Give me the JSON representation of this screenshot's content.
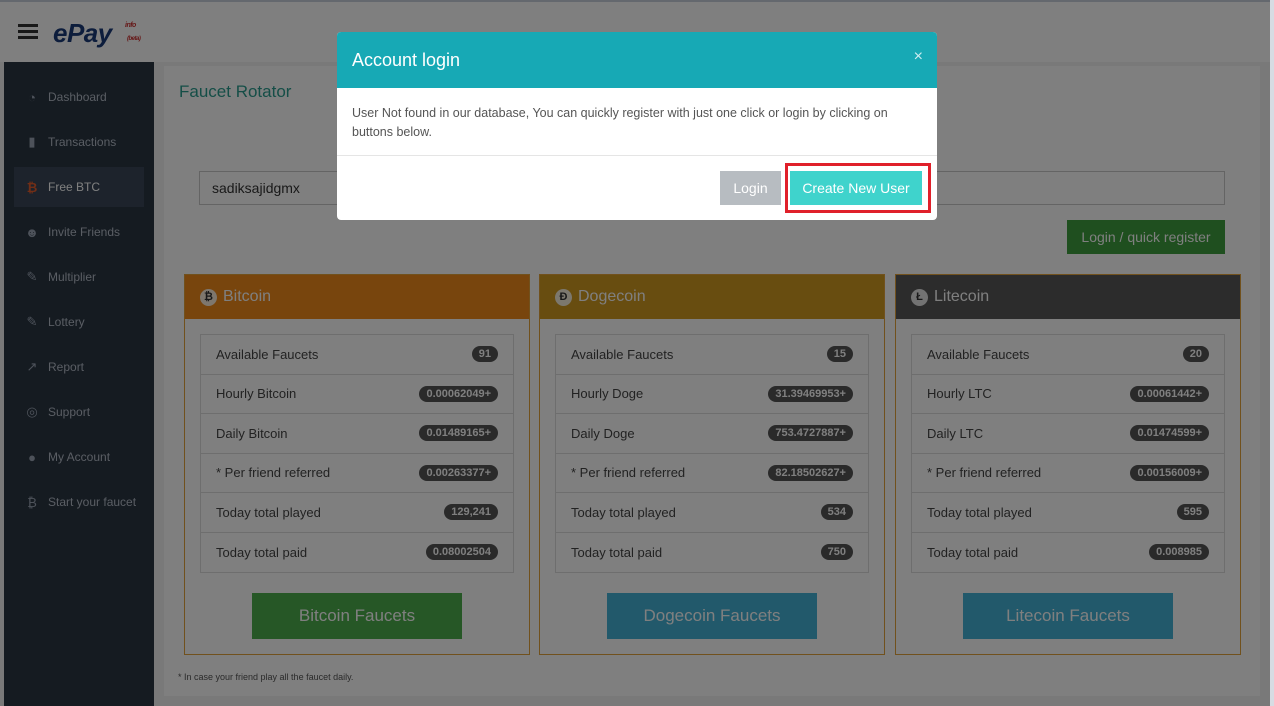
{
  "header": {
    "logo": "ePay",
    "logo_sub": "info",
    "logo_sub2": "(beta)"
  },
  "sidebar": {
    "items": [
      {
        "label": "Dashboard",
        "icon": "dashboard-icon",
        "glyph": "◔"
      },
      {
        "label": "Transactions",
        "icon": "bar-chart-icon",
        "glyph": "▮"
      },
      {
        "label": "Free BTC",
        "icon": "bitcoin-icon",
        "glyph": "₿",
        "active": true
      },
      {
        "label": "Invite Friends",
        "icon": "users-icon",
        "glyph": "☻"
      },
      {
        "label": "Multiplier",
        "icon": "wand-icon",
        "glyph": "✎"
      },
      {
        "label": "Lottery",
        "icon": "ticket-icon",
        "glyph": "✎"
      },
      {
        "label": "Report",
        "icon": "line-chart-icon",
        "glyph": "↗"
      },
      {
        "label": "Support",
        "icon": "lifebuoy-icon",
        "glyph": "◎"
      },
      {
        "label": "My Account",
        "icon": "user-icon",
        "glyph": "●"
      },
      {
        "label": "Start your faucet",
        "icon": "bitcoin-icon",
        "glyph": "₿"
      }
    ]
  },
  "main": {
    "title": "Faucet Rotator",
    "username_value": "sadiksajidgmx",
    "quick_register_label": "Login / quick register",
    "footnote": "* In case your friend play all the faucet daily."
  },
  "cards": {
    "btc": {
      "title": "Bitcoin",
      "coin_glyph": "₿",
      "button": "Bitcoin Faucets",
      "rows": [
        {
          "label": "Available Faucets",
          "value": "91"
        },
        {
          "label": "Hourly Bitcoin",
          "value": "0.00062049+"
        },
        {
          "label": "Daily Bitcoin",
          "value": "0.01489165+"
        },
        {
          "label": "* Per friend referred",
          "value": "0.00263377+"
        },
        {
          "label": "Today total played",
          "value": "129,241"
        },
        {
          "label": "Today total paid",
          "value": "0.08002504"
        }
      ]
    },
    "doge": {
      "title": "Dogecoin",
      "coin_glyph": "Ð",
      "button": "Dogecoin Faucets",
      "rows": [
        {
          "label": "Available Faucets",
          "value": "15"
        },
        {
          "label": "Hourly Doge",
          "value": "31.39469953+"
        },
        {
          "label": "Daily Doge",
          "value": "753.4727887+"
        },
        {
          "label": "* Per friend referred",
          "value": "82.18502627+"
        },
        {
          "label": "Today total played",
          "value": "534"
        },
        {
          "label": "Today total paid",
          "value": "750"
        }
      ]
    },
    "ltc": {
      "title": "Litecoin",
      "coin_glyph": "Ł",
      "button": "Litecoin Faucets",
      "rows": [
        {
          "label": "Available Faucets",
          "value": "20"
        },
        {
          "label": "Hourly LTC",
          "value": "0.00061442+"
        },
        {
          "label": "Daily LTC",
          "value": "0.01474599+"
        },
        {
          "label": "* Per friend referred",
          "value": "0.00156009+"
        },
        {
          "label": "Today total played",
          "value": "595"
        },
        {
          "label": "Today total paid",
          "value": "0.008985"
        }
      ]
    }
  },
  "modal": {
    "title": "Account login",
    "close_glyph": "×",
    "message": "User Not found in our database, You can quickly register with just one click or login by clicking on buttons below.",
    "login_label": "Login",
    "create_label": "Create New User"
  },
  "colors": {
    "modal_header": "#17a9b5",
    "create_button": "#3fd3cc",
    "highlight": "#e0202a",
    "bitcoin": "#f08a1a",
    "dogecoin": "#d19a20",
    "litecoin": "#595959"
  }
}
